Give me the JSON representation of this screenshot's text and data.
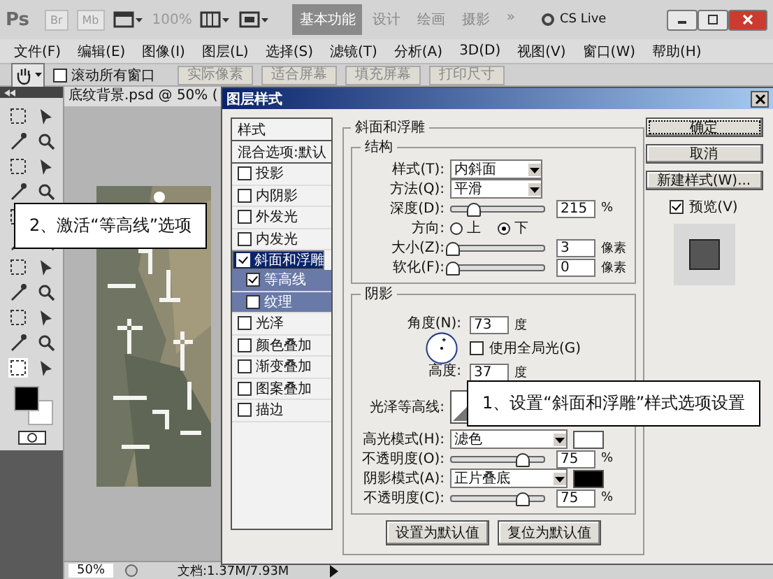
{
  "app_bar": {
    "logo": "Ps",
    "bridge": "Br",
    "mini_bridge": "Mb",
    "zoom": "100%",
    "workspaces": [
      {
        "label": "基本功能",
        "selected": true
      },
      {
        "label": "设计",
        "selected": false
      },
      {
        "label": "绘画",
        "selected": false
      },
      {
        "label": "摄影",
        "selected": false
      }
    ],
    "more": "»",
    "cs_live": "CS Live"
  },
  "menu": [
    "文件(F)",
    "编辑(E)",
    "图像(I)",
    "图层(L)",
    "选择(S)",
    "滤镜(T)",
    "分析(A)",
    "3D(D)",
    "视图(V)",
    "窗口(W)",
    "帮助(H)"
  ],
  "options_bar": {
    "scroll_all": {
      "label": "滚动所有窗口",
      "checked": false
    },
    "buttons": [
      "实际像素",
      "适合屏幕",
      "填充屏幕",
      "打印尺寸"
    ]
  },
  "document": {
    "tab": "底纹背景.psd @ 50% (",
    "zoom": "50%",
    "doc_info": "文档:1.37M/7.93M"
  },
  "dialog": {
    "title": "图层样式",
    "styles": [
      {
        "label": "样式",
        "kind": "header",
        "selected": false
      },
      {
        "label": "混合选项:默认",
        "kind": "header",
        "selected": false
      },
      {
        "label": "投影",
        "kind": "check",
        "checked": false,
        "selected": false
      },
      {
        "label": "内阴影",
        "kind": "check",
        "checked": false,
        "selected": false
      },
      {
        "label": "外发光",
        "kind": "check",
        "checked": false,
        "selected": false
      },
      {
        "label": "内发光",
        "kind": "check",
        "checked": false,
        "selected": false
      },
      {
        "label": "斜面和浮雕",
        "kind": "check",
        "checked": true,
        "selected": true,
        "children": [
          {
            "label": "等高线",
            "kind": "check",
            "checked": true,
            "selected": false
          },
          {
            "label": "纹理",
            "kind": "check",
            "checked": false,
            "selected": false
          }
        ]
      },
      {
        "label": "光泽",
        "kind": "check",
        "checked": false,
        "selected": false
      },
      {
        "label": "颜色叠加",
        "kind": "check",
        "checked": false,
        "selected": false
      },
      {
        "label": "渐变叠加",
        "kind": "check",
        "checked": false,
        "selected": false
      },
      {
        "label": "图案叠加",
        "kind": "check",
        "checked": false,
        "selected": false
      },
      {
        "label": "描边",
        "kind": "check",
        "checked": false,
        "selected": false
      }
    ],
    "section_title": "斜面和浮雕",
    "structure": {
      "title": "结构",
      "style": {
        "label": "样式(T):",
        "value": "内斜面"
      },
      "technique": {
        "label": "方法(Q):",
        "value": "平滑"
      },
      "depth": {
        "label": "深度(D):",
        "level": 0.22,
        "value": "215",
        "unit": "%"
      },
      "direction": {
        "label": "方向:",
        "options": [
          {
            "label": "上",
            "selected": false
          },
          {
            "label": "下",
            "selected": true
          }
        ]
      },
      "size": {
        "label": "大小(Z):",
        "level": 0,
        "value": "3",
        "unit": "像素"
      },
      "soften": {
        "label": "软化(F):",
        "level": 0,
        "value": "0",
        "unit": "像素"
      }
    },
    "shading": {
      "title": "阴影",
      "angle": {
        "label": "角度(N):",
        "value": "73",
        "unit": "度"
      },
      "global_light": {
        "label": "使用全局光(G)",
        "checked": false
      },
      "altitude": {
        "label": "高度:",
        "value": "37",
        "unit": "度"
      },
      "gloss_contour": {
        "label": "光泽等高线:"
      },
      "highlight_mode": {
        "label": "高光模式(H):",
        "value": "滤色",
        "color": "#ffffff"
      },
      "highlight_opacity": {
        "label": "不透明度(O):",
        "level": 0.75,
        "value": "75",
        "unit": "%"
      },
      "shadow_mode": {
        "label": "阴影模式(A):",
        "value": "正片叠底",
        "color": "#000000"
      },
      "shadow_opacity": {
        "label": "不透明度(C):",
        "level": 0.75,
        "value": "75",
        "unit": "%"
      }
    },
    "default_buttons": [
      "设置为默认值",
      "复位为默认值"
    ],
    "ok": "确定",
    "cancel": "取消",
    "new_style": "新建样式(W)...",
    "preview": {
      "label": "预览(V)",
      "checked": true
    }
  },
  "callouts": [
    "2、激活“等高线”选项",
    "1、设置“斜面和浮雕”样式选项设置"
  ]
}
